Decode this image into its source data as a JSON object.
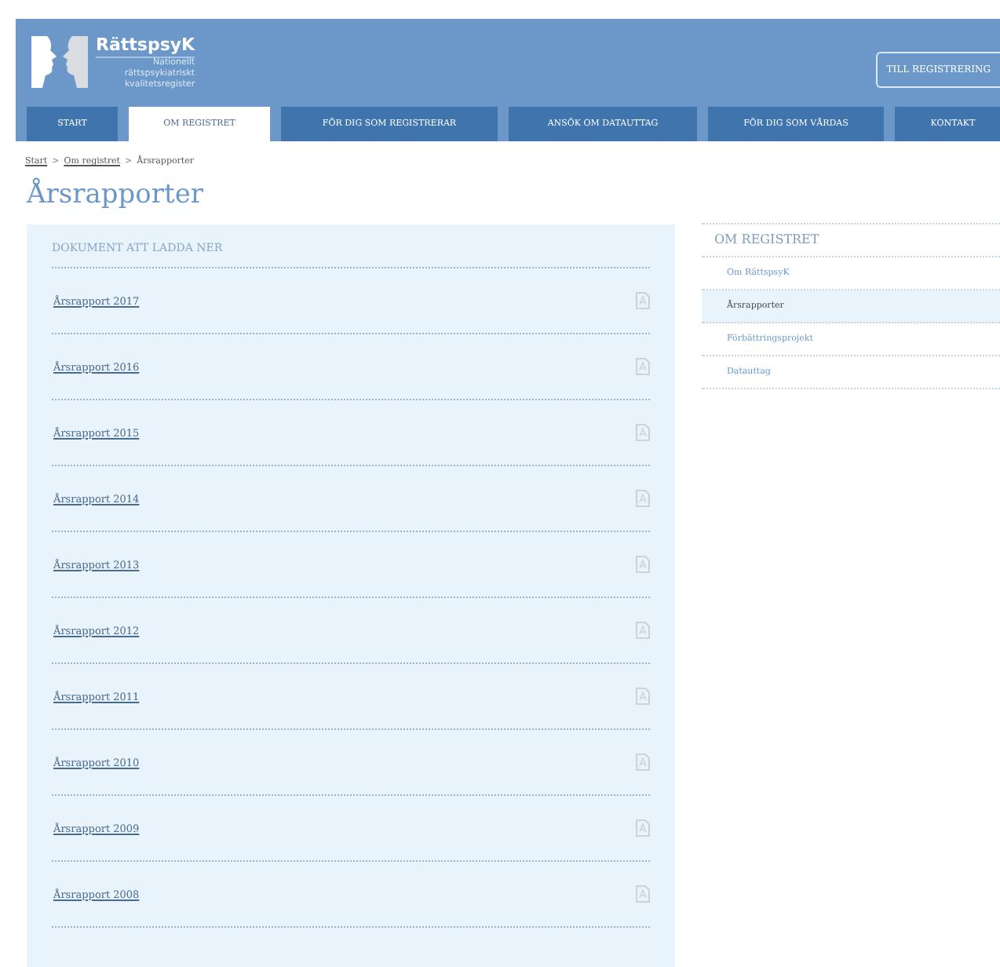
{
  "header": {
    "logo_title": "RättspsyK",
    "logo_subtitle": [
      "Nationellt",
      "rättspsykiatriskt",
      "kvalitetsregister"
    ],
    "register_button": "TILL REGISTRERING"
  },
  "nav": [
    {
      "label": "START",
      "selected": false
    },
    {
      "label": "OM REGISTRET",
      "selected": true
    },
    {
      "label": "FÖR DIG SOM REGISTRERAR",
      "selected": false
    },
    {
      "label": "ANSÖK OM DATAUTTAG",
      "selected": false
    },
    {
      "label": "FÖR DIG SOM VÅRDAS",
      "selected": false
    },
    {
      "label": "KONTAKT",
      "selected": false
    }
  ],
  "breadcrumb": [
    {
      "label": "Start",
      "link": true
    },
    {
      "separator": ">",
      "label": "Om registret",
      "link": true
    },
    {
      "separator": ">",
      "label": "Årsrapporter",
      "link": false
    }
  ],
  "page_title": "Årsrapporter",
  "documents": {
    "heading": "DOKUMENT ATT LADDA NER",
    "items": [
      "Årsrapport 2017",
      "Årsrapport 2016",
      "Årsrapport 2015",
      "Årsrapport 2014",
      "Årsrapport 2013",
      "Årsrapport 2012",
      "Årsrapport 2011",
      "Årsrapport 2010",
      "Årsrapport 2009",
      "Årsrapport 2008"
    ]
  },
  "sidebar": {
    "heading": "OM REGISTRET",
    "items": [
      {
        "label": "Om RättspsyK",
        "selected": false
      },
      {
        "label": "Årsrapporter",
        "selected": true
      },
      {
        "label": "Förbättringsprojekt",
        "selected": false
      },
      {
        "label": "Datauttag",
        "selected": false
      }
    ]
  }
}
